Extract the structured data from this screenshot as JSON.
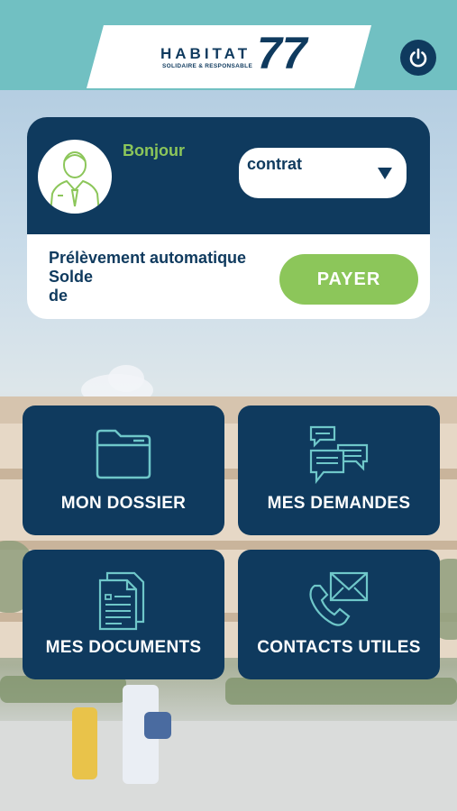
{
  "header": {
    "logo_word": "HABITAT",
    "logo_tagline": "SOLIDAIRE & RESPONSABLE",
    "logo_number": "77",
    "power_icon": "power-icon"
  },
  "account": {
    "greeting": "Bonjour",
    "avatar_icon": "user-avatar-icon",
    "contract_select": {
      "value": "contrat",
      "arrow_icon": "dropdown-triangle-icon"
    },
    "payment_method": "Prélèvement automatique",
    "balance_label": "Solde",
    "balance_suffix": "de",
    "pay_button": "PAYER"
  },
  "tiles": [
    {
      "label": "MON DOSSIER",
      "icon": "folder-icon"
    },
    {
      "label": "MES DEMANDES",
      "icon": "chat-bubbles-icon"
    },
    {
      "label": "MES DOCUMENTS",
      "icon": "documents-icon"
    },
    {
      "label": "CONTACTS UTILES",
      "icon": "phone-envelope-icon"
    }
  ],
  "colors": {
    "header_bg": "#71c0c2",
    "navy": "#0f3a5e",
    "accent_green": "#8cc65a",
    "white": "#ffffff"
  }
}
